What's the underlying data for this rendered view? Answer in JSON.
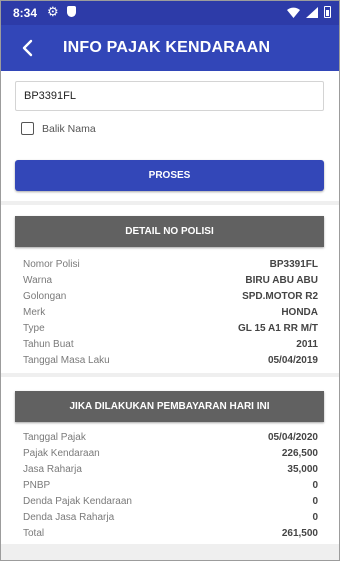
{
  "status_bar": {
    "time": "8:34"
  },
  "app_bar": {
    "title": "INFO PAJAK KENDARAAN"
  },
  "form": {
    "plate_value": "BP3391FL",
    "checkbox_label": "Balik Nama",
    "checkbox_checked": false,
    "proses_label": "PROSES"
  },
  "detail_section": {
    "title": "DETAIL NO POLISI",
    "rows": [
      {
        "label": "Nomor Polisi",
        "value": "BP3391FL"
      },
      {
        "label": "Warna",
        "value": "BIRU ABU ABU"
      },
      {
        "label": "Golongan",
        "value": "SPD.MOTOR R2"
      },
      {
        "label": "Merk",
        "value": "HONDA"
      },
      {
        "label": "Type",
        "value": "GL 15 A1 RR M/T"
      },
      {
        "label": "Tahun Buat",
        "value": "2011"
      },
      {
        "label": "Tanggal Masa Laku",
        "value": "05/04/2019"
      }
    ]
  },
  "payment_section": {
    "title": "JIKA DILAKUKAN PEMBAYARAN HARI INI",
    "rows": [
      {
        "label": "Tanggal Pajak",
        "value": "05/04/2020"
      },
      {
        "label": "Pajak Kendaraan",
        "value": "226,500"
      },
      {
        "label": "Jasa Raharja",
        "value": "35,000"
      },
      {
        "label": "PNBP",
        "value": "0"
      },
      {
        "label": "Denda Pajak Kendaraan",
        "value": "0"
      },
      {
        "label": "Denda Jasa Raharja",
        "value": "0"
      },
      {
        "label": "Total",
        "value": "261,500"
      }
    ]
  },
  "colors": {
    "app_bar": "#3246b8",
    "status_bar": "#2d3ba8",
    "proses_button": "#3347b8",
    "section_header": "#616161"
  },
  "icons": {
    "back": "arrow-left-icon",
    "settings": "gear-icon",
    "shield": "shield-icon",
    "wifi": "wifi-icon",
    "signal": "signal-icon",
    "battery": "battery-icon"
  }
}
